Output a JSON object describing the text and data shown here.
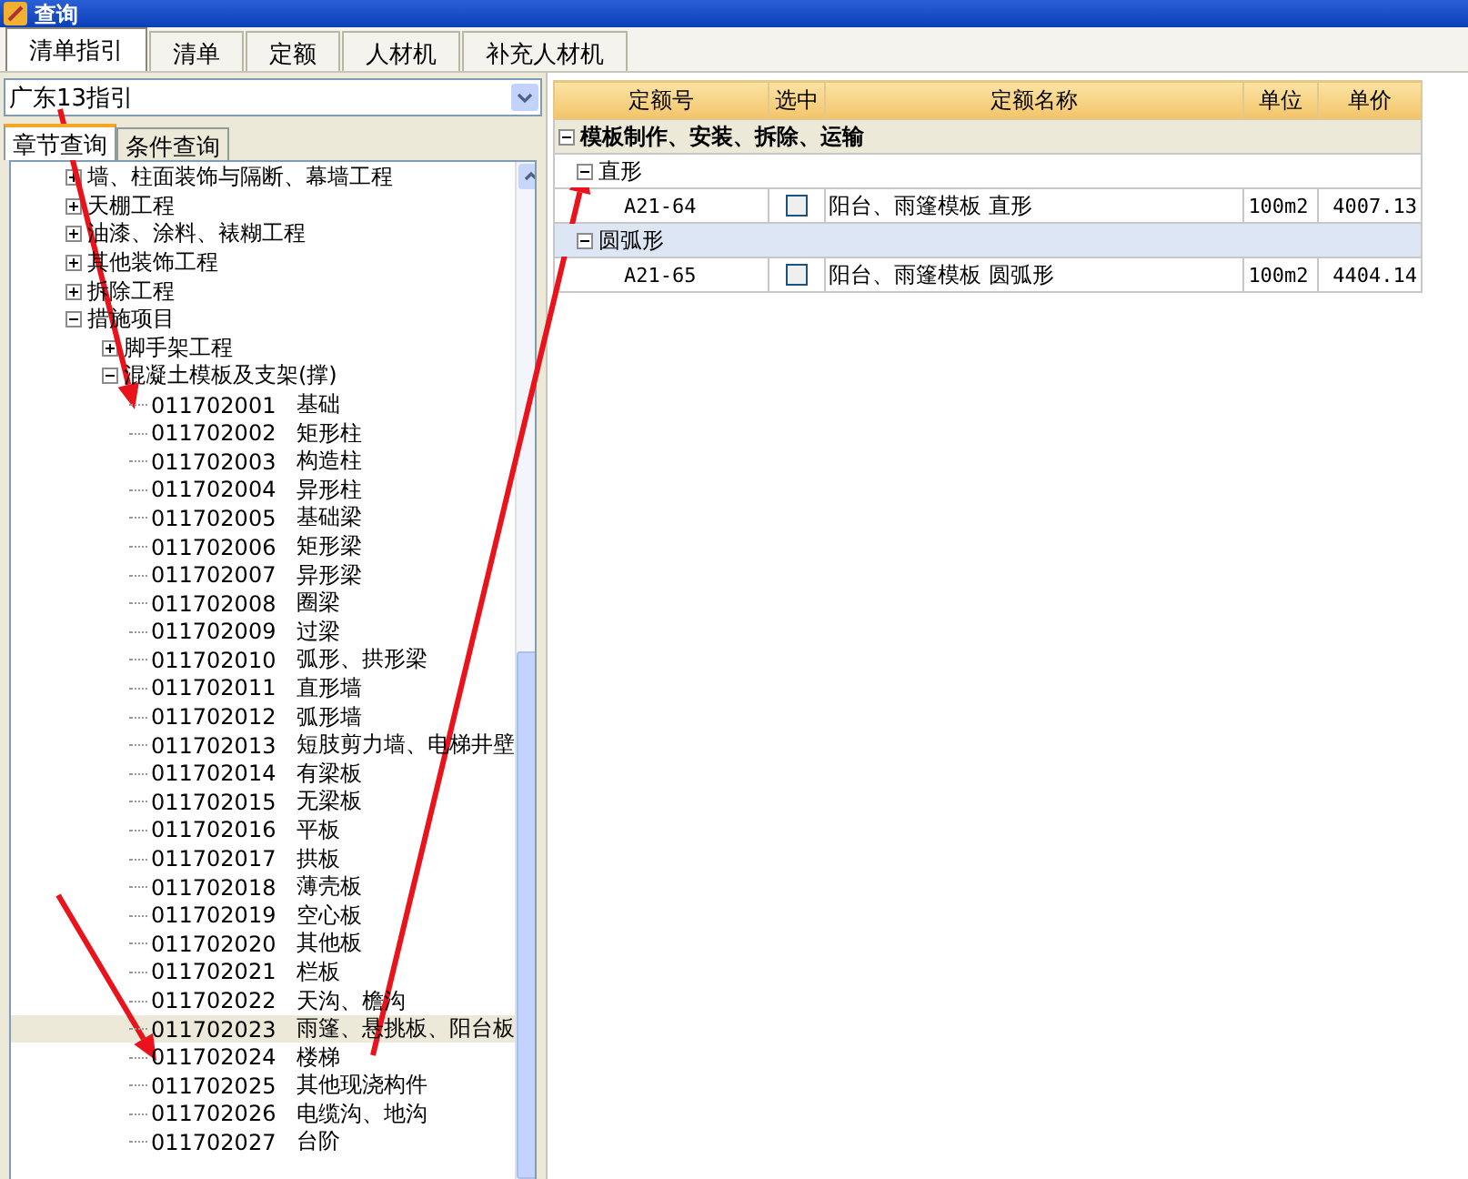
{
  "window": {
    "title": "查询"
  },
  "tabs": [
    {
      "label": "清单指引",
      "selected": true
    },
    {
      "label": "清单",
      "selected": false
    },
    {
      "label": "定额",
      "selected": false
    },
    {
      "label": "人材机",
      "selected": false
    },
    {
      "label": "补充人材机",
      "selected": false
    }
  ],
  "guide_select": {
    "value": "广东13指引"
  },
  "sub_tabs": [
    {
      "label": "章节查询",
      "selected": true
    },
    {
      "label": "条件查询",
      "selected": false
    }
  ],
  "tree": {
    "items": [
      {
        "kind": "node",
        "label": "墙、柱面装饰与隔断、幕墙工程",
        "expanded": false,
        "selected": false
      },
      {
        "kind": "node",
        "label": "天棚工程",
        "expanded": false,
        "selected": false
      },
      {
        "kind": "node",
        "label": "油漆、涂料、裱糊工程",
        "expanded": false,
        "selected": false
      },
      {
        "kind": "node",
        "label": "其他装饰工程",
        "expanded": false,
        "selected": false
      },
      {
        "kind": "node",
        "label": "拆除工程",
        "expanded": false,
        "selected": false
      },
      {
        "kind": "node",
        "label": "措施项目",
        "expanded": true,
        "selected": false,
        "children": [
          {
            "kind": "node",
            "label": "脚手架工程",
            "expanded": false,
            "selected": false
          },
          {
            "kind": "node",
            "label": "混凝土模板及支架(撑)",
            "expanded": true,
            "selected": false,
            "children": [
              {
                "kind": "leaf",
                "code": "011702001",
                "name": "基础",
                "selected": false
              },
              {
                "kind": "leaf",
                "code": "011702002",
                "name": "矩形柱",
                "selected": false
              },
              {
                "kind": "leaf",
                "code": "011702003",
                "name": "构造柱",
                "selected": false
              },
              {
                "kind": "leaf",
                "code": "011702004",
                "name": "异形柱",
                "selected": false
              },
              {
                "kind": "leaf",
                "code": "011702005",
                "name": "基础梁",
                "selected": false
              },
              {
                "kind": "leaf",
                "code": "011702006",
                "name": "矩形梁",
                "selected": false
              },
              {
                "kind": "leaf",
                "code": "011702007",
                "name": "异形梁",
                "selected": false
              },
              {
                "kind": "leaf",
                "code": "011702008",
                "name": "圈梁",
                "selected": false
              },
              {
                "kind": "leaf",
                "code": "011702009",
                "name": "过梁",
                "selected": false
              },
              {
                "kind": "leaf",
                "code": "011702010",
                "name": "弧形、拱形梁",
                "selected": false
              },
              {
                "kind": "leaf",
                "code": "011702011",
                "name": "直形墙",
                "selected": false
              },
              {
                "kind": "leaf",
                "code": "011702012",
                "name": "弧形墙",
                "selected": false
              },
              {
                "kind": "leaf",
                "code": "011702013",
                "name": "短肢剪力墙、电梯井壁",
                "selected": false
              },
              {
                "kind": "leaf",
                "code": "011702014",
                "name": "有梁板",
                "selected": false
              },
              {
                "kind": "leaf",
                "code": "011702015",
                "name": "无梁板",
                "selected": false
              },
              {
                "kind": "leaf",
                "code": "011702016",
                "name": "平板",
                "selected": false
              },
              {
                "kind": "leaf",
                "code": "011702017",
                "name": "拱板",
                "selected": false
              },
              {
                "kind": "leaf",
                "code": "011702018",
                "name": "薄壳板",
                "selected": false
              },
              {
                "kind": "leaf",
                "code": "011702019",
                "name": "空心板",
                "selected": false
              },
              {
                "kind": "leaf",
                "code": "011702020",
                "name": "其他板",
                "selected": false
              },
              {
                "kind": "leaf",
                "code": "011702021",
                "name": "栏板",
                "selected": false
              },
              {
                "kind": "leaf",
                "code": "011702022",
                "name": "天沟、檐沟",
                "selected": false
              },
              {
                "kind": "leaf",
                "code": "011702023",
                "name": "雨篷、悬挑板、阳台板",
                "selected": true
              },
              {
                "kind": "leaf",
                "code": "011702024",
                "name": "楼梯",
                "selected": false
              },
              {
                "kind": "leaf",
                "code": "011702025",
                "name": "其他现浇构件",
                "selected": false
              },
              {
                "kind": "leaf",
                "code": "011702026",
                "name": "电缆沟、地沟",
                "selected": false
              },
              {
                "kind": "leaf",
                "code": "011702027",
                "name": "台阶",
                "selected": false
              }
            ]
          }
        ]
      }
    ]
  },
  "grid": {
    "columns": [
      "定额号",
      "选中",
      "定额名称",
      "单位",
      "单价"
    ],
    "groups": [
      {
        "label": "模板制作、安装、拆除、运输",
        "expanded": true,
        "children": [
          {
            "label": "直形",
            "expanded": true,
            "selected": false,
            "rows": [
              {
                "code": "A21-64",
                "checked": false,
                "name": "阳台、雨篷模板 直形",
                "unit": "100m2",
                "price": "4007.13"
              }
            ]
          },
          {
            "label": "圆弧形",
            "expanded": true,
            "selected": true,
            "rows": [
              {
                "code": "A21-65",
                "checked": false,
                "name": "阳台、雨篷模板 圆弧形",
                "unit": "100m2",
                "price": "4404.14"
              }
            ]
          }
        ]
      }
    ]
  }
}
